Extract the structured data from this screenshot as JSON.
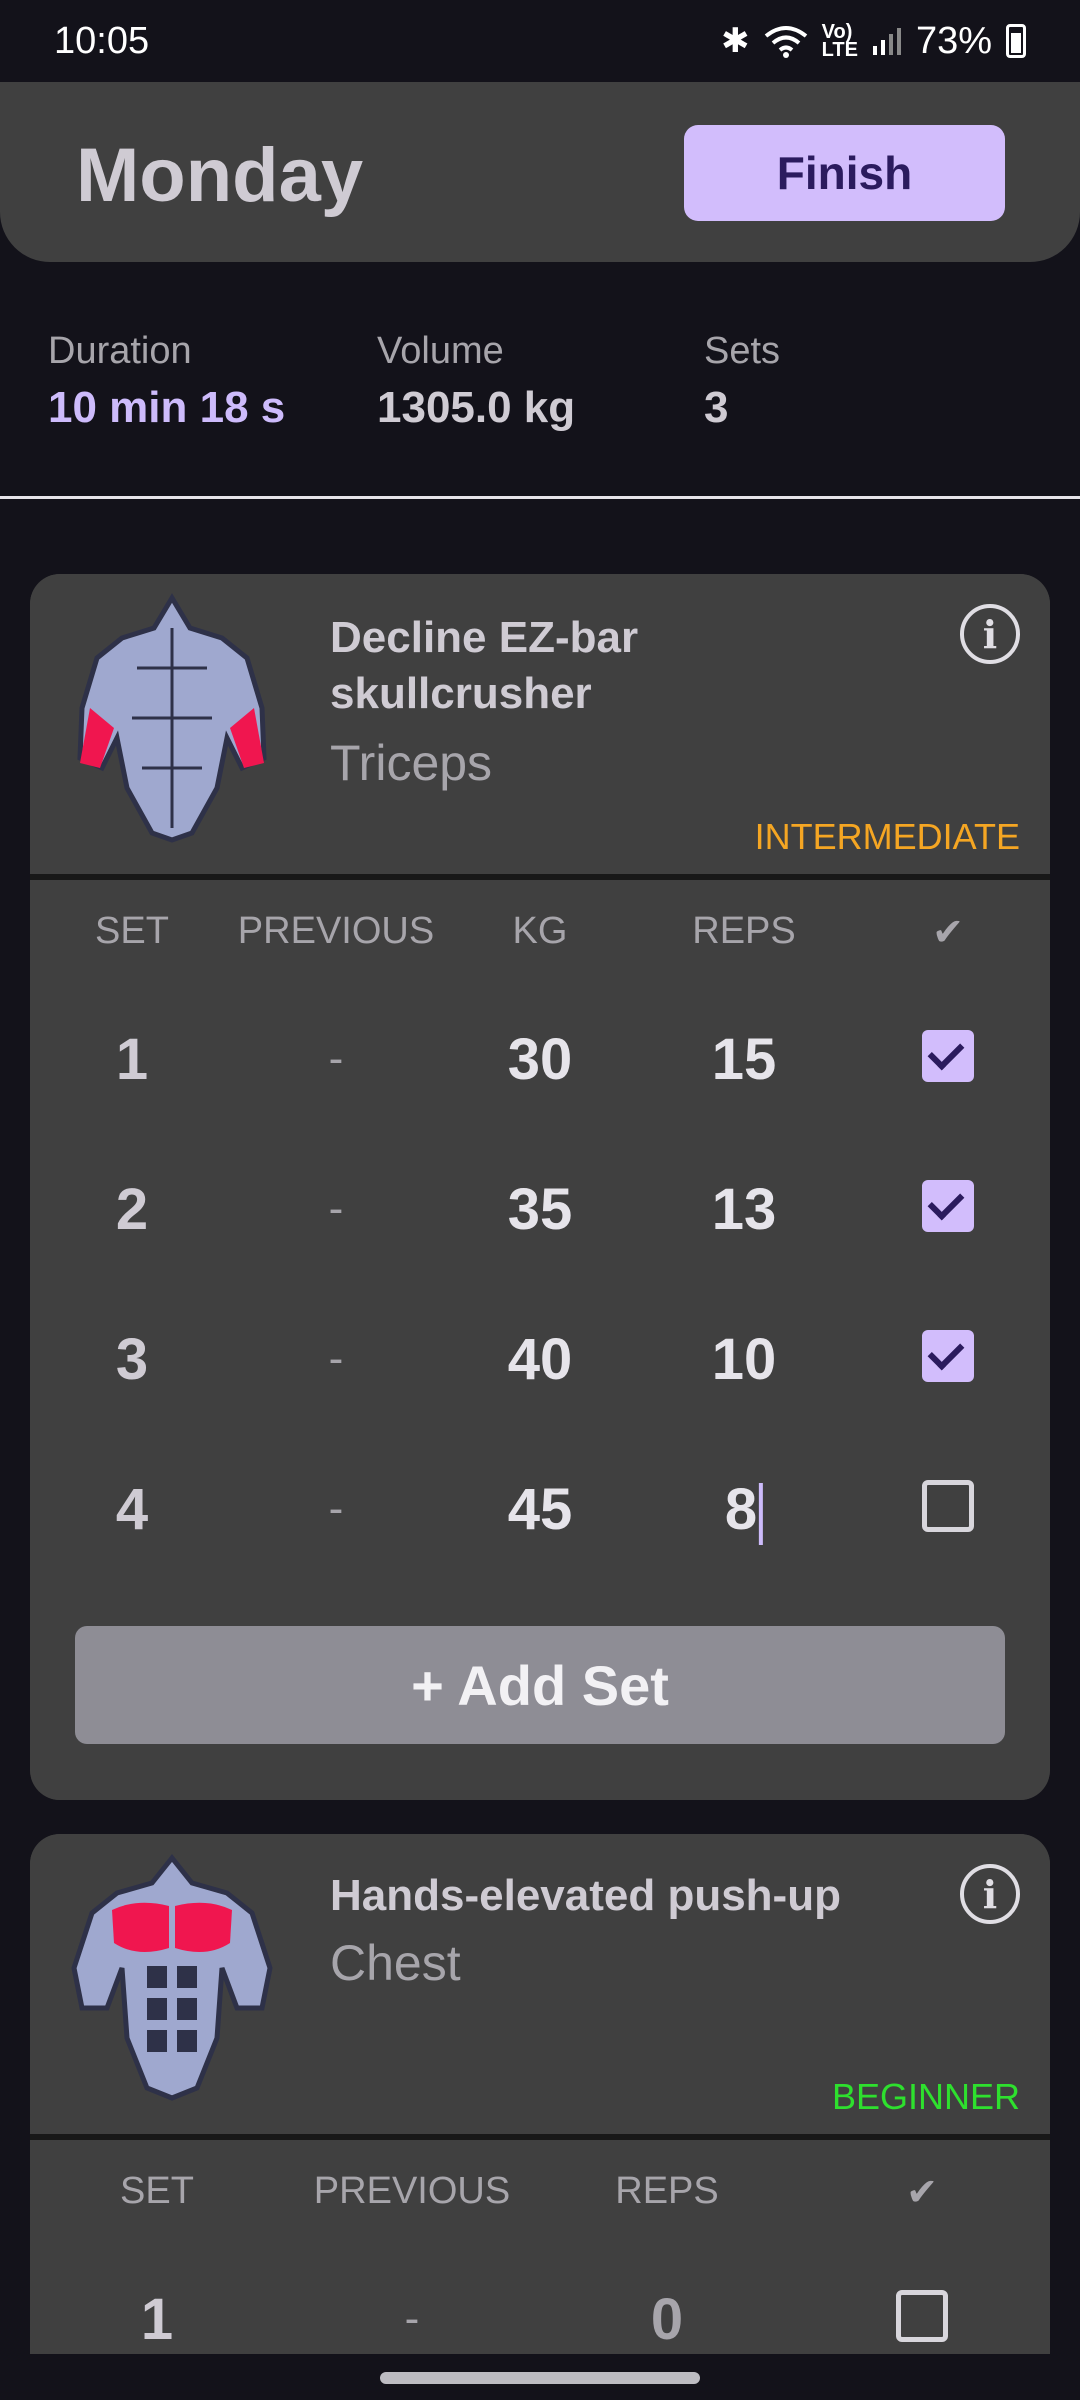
{
  "status_bar": {
    "time": "10:05",
    "battery": "73%",
    "icons": [
      "bluetooth-icon",
      "wifi-icon",
      "volte-icon",
      "signal-icon",
      "battery-icon"
    ]
  },
  "header": {
    "title": "Monday",
    "finish_label": "Finish"
  },
  "stats": [
    {
      "label": "Duration",
      "value": "10 min 18 s"
    },
    {
      "label": "Volume",
      "value": "1305.0 kg"
    },
    {
      "label": "Sets",
      "value": "3"
    }
  ],
  "exercises": [
    {
      "name_line1": "Decline EZ-bar",
      "name_line2": "skullcrusher",
      "muscle": "Triceps",
      "level": "INTERMEDIATE",
      "level_color": "#f5a623",
      "headers": [
        "SET",
        "PREVIOUS",
        "KG",
        "REPS",
        "✔"
      ],
      "rows": [
        {
          "set": "1",
          "previous": "-",
          "kg": "30",
          "reps": "15",
          "done": true
        },
        {
          "set": "2",
          "previous": "-",
          "kg": "35",
          "reps": "13",
          "done": true
        },
        {
          "set": "3",
          "previous": "-",
          "kg": "40",
          "reps": "10",
          "done": true
        },
        {
          "set": "4",
          "previous": "-",
          "kg": "45",
          "reps": "8",
          "done": false
        }
      ],
      "add_set_label": "+ Add Set"
    },
    {
      "name": "Hands-elevated push-up",
      "muscle": "Chest",
      "level": "BEGINNER",
      "level_color": "#2ee02e",
      "headers": [
        "SET",
        "PREVIOUS",
        "REPS",
        "✔"
      ],
      "rows": [
        {
          "set": "1",
          "previous": "-",
          "reps": "0",
          "done": false
        }
      ]
    }
  ],
  "colors": {
    "accent": "#d2bdfc",
    "background": "#13121a",
    "card": "#404040"
  }
}
